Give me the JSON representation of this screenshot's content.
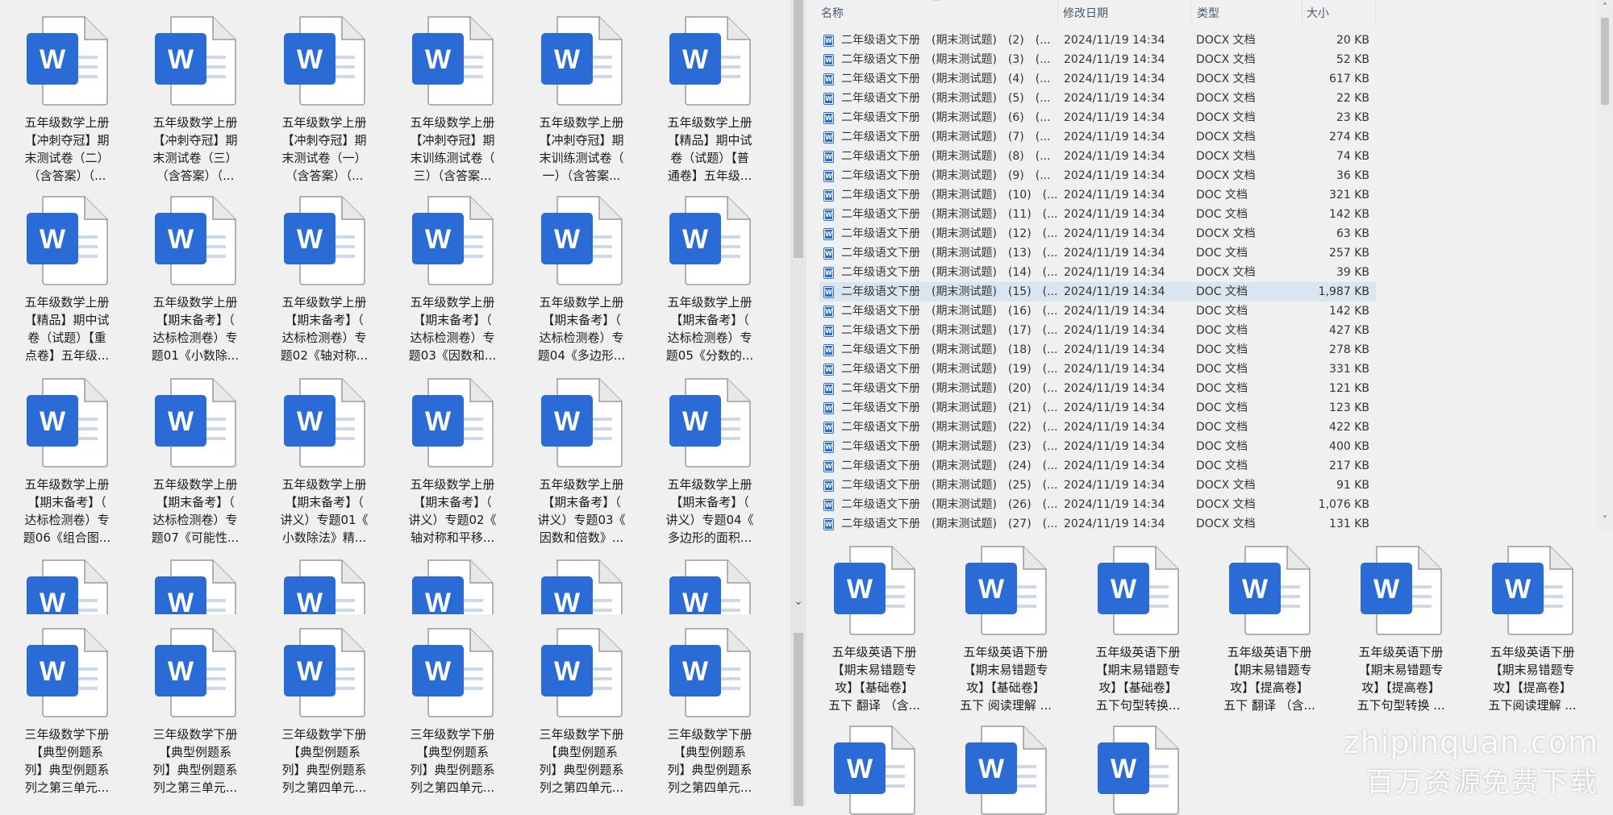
{
  "left_pane": {
    "rows": [
      [
        [
          "五年级数学上册",
          "【冲刺夺冠】期",
          "末测试卷（二）",
          "（含答案）（..."
        ],
        [
          "五年级数学上册",
          "【冲刺夺冠】期",
          "末测试卷（三）",
          "（含答案）（..."
        ],
        [
          "五年级数学上册",
          "【冲刺夺冠】期",
          "末测试卷（一）",
          "（含答案）（..."
        ],
        [
          "五年级数学上册",
          "【冲刺夺冠】期",
          "末训练测试卷（",
          "三）（含答案..."
        ],
        [
          "五年级数学上册",
          "【冲刺夺冠】期",
          "末训练测试卷（",
          "一）（含答案..."
        ],
        [
          "五年级数学上册",
          "【精品】期中试",
          "卷（试题）【普",
          "通卷】五年级..."
        ]
      ],
      [
        [
          "五年级数学上册",
          "【精品】期中试",
          "卷（试题）【重",
          "点卷】五年级..."
        ],
        [
          "五年级数学上册",
          "【期末备考】（",
          "达标检测卷）专",
          "题01《小数除..."
        ],
        [
          "五年级数学上册",
          "【期末备考】（",
          "达标检测卷）专",
          "题02《轴对称..."
        ],
        [
          "五年级数学上册",
          "【期末备考】（",
          "达标检测卷）专",
          "题03《因数和..."
        ],
        [
          "五年级数学上册",
          "【期末备考】（",
          "达标检测卷）专",
          "题04《多边形..."
        ],
        [
          "五年级数学上册",
          "【期末备考】（",
          "达标检测卷）专",
          "题05《分数的..."
        ]
      ],
      [
        [
          "五年级数学上册",
          "【期末备考】（",
          "达标检测卷）专",
          "题06《组合图..."
        ],
        [
          "五年级数学上册",
          "【期末备考】（",
          "达标检测卷）专",
          "题07《可能性..."
        ],
        [
          "五年级数学上册",
          "【期末备考】（",
          "讲义）专题01《",
          "小数除法》精..."
        ],
        [
          "五年级数学上册",
          "【期末备考】（",
          "讲义）专题02《",
          "轴对称和平移..."
        ],
        [
          "五年级数学上册",
          "【期末备考】（",
          "讲义）专题03《",
          "因数和倍数》..."
        ],
        [
          "五年级数学上册",
          "【期末备考】（",
          "讲义）专题04《",
          "多边形的面积..."
        ]
      ],
      [
        [
          "三年级数学下册",
          "【典型例题系",
          "列】典型例题系",
          "列之第三单元..."
        ],
        [
          "三年级数学下册",
          "【典型例题系",
          "列】典型例题系",
          "列之第三单元..."
        ],
        [
          "三年级数学下册",
          "【典型例题系",
          "列】典型例题系",
          "列之第四单元..."
        ],
        [
          "三年级数学下册",
          "【典型例题系",
          "列】典型例题系",
          "列之第四单元..."
        ],
        [
          "三年级数学下册",
          "【典型例题系",
          "列】典型例题系",
          "列之第四单元..."
        ],
        [
          "三年级数学下册",
          "【典型例题系",
          "列】典型例题系",
          "列之第四单元..."
        ]
      ]
    ]
  },
  "details": {
    "headers": {
      "name": "名称",
      "date": "修改日期",
      "type": "类型",
      "size": "大小"
    },
    "rows": [
      {
        "name": "二年级语文下册　(期末测试题)　(2)　(...",
        "date": "2024/11/19 14:34",
        "type": "DOCX 文档",
        "size": "20 KB"
      },
      {
        "name": "二年级语文下册　(期末测试题)　(3)　(...",
        "date": "2024/11/19 14:34",
        "type": "DOCX 文档",
        "size": "52 KB"
      },
      {
        "name": "二年级语文下册　(期末测试题)　(4)　(...",
        "date": "2024/11/19 14:34",
        "type": "DOCX 文档",
        "size": "617 KB"
      },
      {
        "name": "二年级语文下册　(期末测试题)　(5)　(...",
        "date": "2024/11/19 14:34",
        "type": "DOCX 文档",
        "size": "22 KB"
      },
      {
        "name": "二年级语文下册　(期末测试题)　(6)　(...",
        "date": "2024/11/19 14:34",
        "type": "DOCX 文档",
        "size": "23 KB"
      },
      {
        "name": "二年级语文下册　(期末测试题)　(7)　(...",
        "date": "2024/11/19 14:34",
        "type": "DOCX 文档",
        "size": "274 KB"
      },
      {
        "name": "二年级语文下册　(期末测试题)　(8)　(...",
        "date": "2024/11/19 14:34",
        "type": "DOCX 文档",
        "size": "74 KB"
      },
      {
        "name": "二年级语文下册　(期末测试题)　(9)　(...",
        "date": "2024/11/19 14:34",
        "type": "DOCX 文档",
        "size": "36 KB"
      },
      {
        "name": "二年级语文下册　(期末测试题)　(10)　(...",
        "date": "2024/11/19 14:34",
        "type": "DOC 文档",
        "size": "321 KB"
      },
      {
        "name": "二年级语文下册　(期末测试题)　(11)　(...",
        "date": "2024/11/19 14:34",
        "type": "DOC 文档",
        "size": "142 KB"
      },
      {
        "name": "二年级语文下册　(期末测试题)　(12)　(...",
        "date": "2024/11/19 14:34",
        "type": "DOCX 文档",
        "size": "63 KB"
      },
      {
        "name": "二年级语文下册　(期末测试题)　(13)　(...",
        "date": "2024/11/19 14:34",
        "type": "DOC 文档",
        "size": "257 KB"
      },
      {
        "name": "二年级语文下册　(期末测试题)　(14)　(...",
        "date": "2024/11/19 14:34",
        "type": "DOCX 文档",
        "size": "39 KB"
      },
      {
        "name": "二年级语文下册　(期末测试题)　(15)　(...",
        "date": "2024/11/19 14:34",
        "type": "DOC 文档",
        "size": "1,987 KB",
        "selected": true
      },
      {
        "name": "二年级语文下册　(期末测试题)　(16)　(...",
        "date": "2024/11/19 14:34",
        "type": "DOC 文档",
        "size": "142 KB"
      },
      {
        "name": "二年级语文下册　(期末测试题)　(17)　(...",
        "date": "2024/11/19 14:34",
        "type": "DOC 文档",
        "size": "427 KB"
      },
      {
        "name": "二年级语文下册　(期末测试题)　(18)　(...",
        "date": "2024/11/19 14:34",
        "type": "DOC 文档",
        "size": "278 KB"
      },
      {
        "name": "二年级语文下册　(期末测试题)　(19)　(...",
        "date": "2024/11/19 14:34",
        "type": "DOC 文档",
        "size": "331 KB"
      },
      {
        "name": "二年级语文下册　(期末测试题)　(20)　(...",
        "date": "2024/11/19 14:34",
        "type": "DOC 文档",
        "size": "121 KB"
      },
      {
        "name": "二年级语文下册　(期末测试题)　(21)　(...",
        "date": "2024/11/19 14:34",
        "type": "DOC 文档",
        "size": "123 KB"
      },
      {
        "name": "二年级语文下册　(期末测试题)　(22)　(...",
        "date": "2024/11/19 14:34",
        "type": "DOC 文档",
        "size": "422 KB"
      },
      {
        "name": "二年级语文下册　(期末测试题)　(23)　(...",
        "date": "2024/11/19 14:34",
        "type": "DOC 文档",
        "size": "400 KB"
      },
      {
        "name": "二年级语文下册　(期末测试题)　(24)　(...",
        "date": "2024/11/19 14:34",
        "type": "DOC 文档",
        "size": "217 KB"
      },
      {
        "name": "二年级语文下册　(期末测试题)　(25)　(...",
        "date": "2024/11/19 14:34",
        "type": "DOCX 文档",
        "size": "91 KB"
      },
      {
        "name": "二年级语文下册　(期末测试题)　(26)　(...",
        "date": "2024/11/19 14:34",
        "type": "DOCX 文档",
        "size": "1,076 KB"
      },
      {
        "name": "二年级语文下册　(期末测试题)　(27)　(...",
        "date": "2024/11/19 14:34",
        "type": "DOCX 文档",
        "size": "131 KB"
      }
    ]
  },
  "right_icons": [
    [
      "五年级英语下册",
      "【期末易错题专",
      "攻】【基础卷】",
      "五下 翻译 （含..."
    ],
    [
      "五年级英语下册",
      "【期末易错题专",
      "攻】【基础卷】",
      "五下 阅读理解 ..."
    ],
    [
      "五年级英语下册",
      "【期末易错题专",
      "攻】【基础卷】",
      "五下句型转换..."
    ],
    [
      "五年级英语下册",
      "【期末易错题专",
      "攻】【提高卷】",
      "五下 翻译 （含..."
    ],
    [
      "五年级英语下册",
      "【期末易错题专",
      "攻】【提高卷】",
      "五下句型转换 ..."
    ],
    [
      "五年级英语下册",
      "【期末易错题专",
      "攻】【提高卷】",
      "五下阅读理解 ..."
    ]
  ],
  "watermark": {
    "domain": "zhipinquan.com",
    "slogan": "百万资源免费下载"
  },
  "colors": {
    "word_blue": "#2b6bd6",
    "selection": "#d9e6f2"
  }
}
